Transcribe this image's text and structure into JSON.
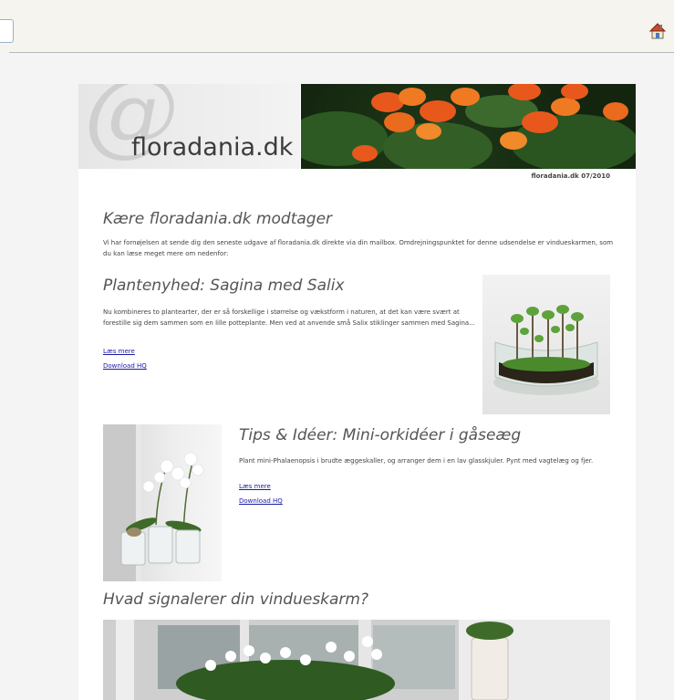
{
  "newsletter": {
    "logo_text": "floradania.dk",
    "issue": "floradania.dk 07/2010",
    "greeting_title": "Kære floradania.dk modtager",
    "intro": "Vi har fornøjelsen at sende dig den seneste udgave af floradania.dk direkte via din mailbox. Omdrejningspunktet for denne udsendelse er vindueskarmen, som du kan læse meget mere om nedenfor:",
    "articles": [
      {
        "title": "Plantenyhed: Sagina med Salix",
        "body": "Nu kombineres to plantearter, der er så forskellige i størrelse og vækstform i naturen, at det kan være svært at forestille sig dem sammen som en lille potteplante. Men ved at anvende små Salix stiklinger sammen med Sagina...",
        "read_more": "Læs mere",
        "download": "Download HQ"
      },
      {
        "title": "Tips & Idéer: Mini-orkidéer i gåseæg",
        "body": "Plant mini-Phalaenopsis i brudte æggeskaller, og arranger dem i en lav glasskjuler. Pynt med vagtelæg og fjer.",
        "read_more": "Læs mere",
        "download": "Download HQ"
      }
    ],
    "section3_title": "Hvad signalerer din vindueskarm?"
  },
  "icons": {
    "home": "home-icon"
  },
  "colors": {
    "link": "#1a1aa6",
    "heading": "#555555",
    "flower_orange": "#e8581c"
  }
}
